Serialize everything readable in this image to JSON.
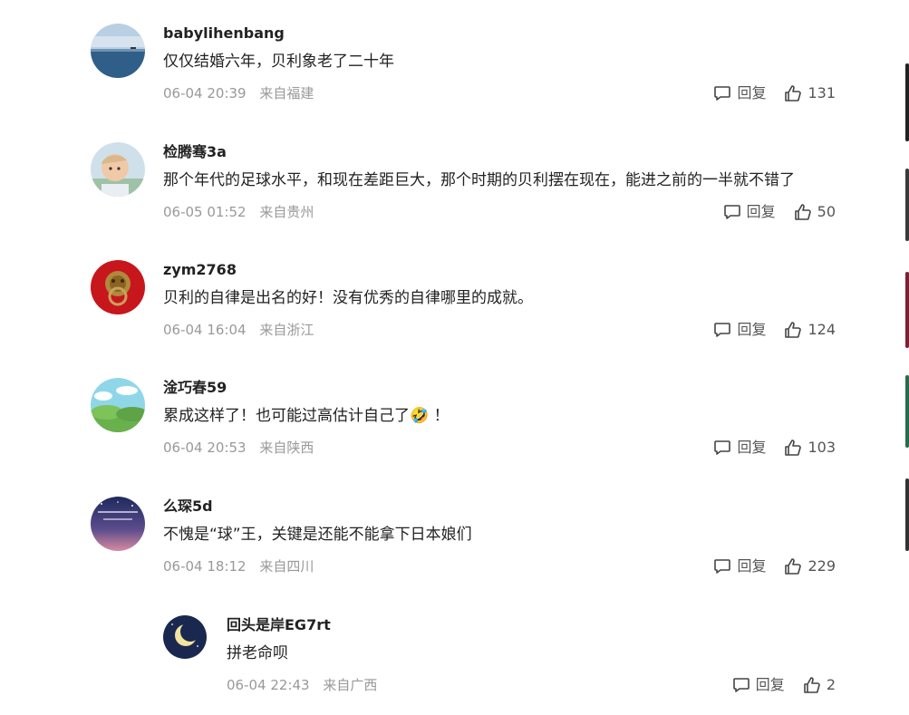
{
  "comments": [
    {
      "username": "babylihenbang",
      "text": "仅仅结婚六年，贝利象老了二十年",
      "time": "06-04 20:39",
      "location": "来自福建",
      "reply_label": "回复",
      "likes": "131"
    },
    {
      "username": "检腾骞3a",
      "text": "那个年代的足球水平，和现在差距巨大，那个时期的贝利摆在现在，能进之前的一半就不错了",
      "time": "06-05 01:52",
      "location": "来自贵州",
      "reply_label": "回复",
      "likes": "50"
    },
    {
      "username": "zym2768",
      "text": "贝利的自律是出名的好！没有优秀的自律哪里的成就。",
      "time": "06-04 16:04",
      "location": "来自浙江",
      "reply_label": "回复",
      "likes": "124"
    },
    {
      "username": "淦巧春59",
      "text": "累成这样了！也可能过高估计自己了",
      "emoji_after": "🤣",
      "text_tail": " ！",
      "time": "06-04 20:53",
      "location": "来自陕西",
      "reply_label": "回复",
      "likes": "103"
    },
    {
      "username": "么琛5d",
      "text": "不愧是“球”王，关键是还能不能拿下日本娘们",
      "time": "06-04 18:12",
      "location": "来自四川",
      "reply_label": "回复",
      "likes": "229"
    }
  ],
  "reply": {
    "username": "回头是岸EG7rt",
    "text": "拼老命呗",
    "time": "06-04 22:43",
    "location": "来自广西",
    "reply_label": "回复",
    "likes": "2"
  },
  "icons": {
    "reply": "comment-bubble-icon",
    "like": "thumbs-up-icon"
  },
  "colors": {
    "meta": "#999999",
    "text": "#222222",
    "actions": "#555555"
  }
}
